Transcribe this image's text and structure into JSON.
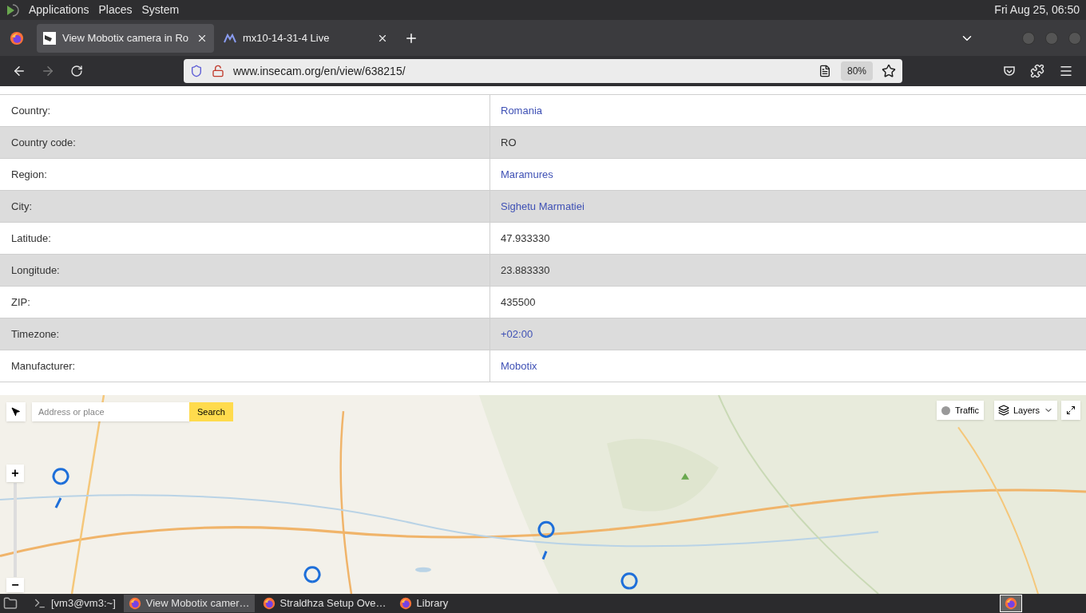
{
  "top_panel": {
    "menus": [
      "Applications",
      "Places",
      "System"
    ],
    "clock": "Fri Aug 25, 06:50"
  },
  "tabs": [
    {
      "title": "View Mobotix camera in Ro",
      "selected": true,
      "kind": "camera"
    },
    {
      "title": "mx10-14-31-4 Live",
      "selected": false,
      "kind": "logo"
    }
  ],
  "address_bar": {
    "url": "www.insecam.org/en/view/638215/",
    "zoom": "80%"
  },
  "details": [
    {
      "label": "Country:",
      "value": "Romania",
      "link": true
    },
    {
      "label": "Country code:",
      "value": "RO",
      "link": false
    },
    {
      "label": "Region:",
      "value": "Maramures",
      "link": true
    },
    {
      "label": "City:",
      "value": "Sighetu Marmatiei",
      "link": true
    },
    {
      "label": "Latitude:",
      "value": "47.933330",
      "link": false
    },
    {
      "label": "Longitude:",
      "value": "23.883330",
      "link": false
    },
    {
      "label": "ZIP:",
      "value": "435500",
      "link": false
    },
    {
      "label": "Timezone:",
      "value": "+02:00",
      "link": true
    },
    {
      "label": "Manufacturer:",
      "value": "Mobotix",
      "link": true
    }
  ],
  "map": {
    "kind": "picture",
    "search": {
      "placeholder": "Address or place",
      "button": "Search"
    },
    "traffic": "Traffic",
    "layers": "Layers",
    "zoom_in": "+",
    "zoom_out": "−"
  },
  "taskbar": [
    {
      "title": "[vm3@vm3:~]",
      "selected": false,
      "kind": "terminal"
    },
    {
      "title": "View Mobotix camer…",
      "selected": true,
      "kind": "browser"
    },
    {
      "title": "Straldhza Setup Ove…",
      "selected": false,
      "kind": "browser"
    },
    {
      "title": "Library",
      "selected": false,
      "kind": "browser"
    }
  ]
}
